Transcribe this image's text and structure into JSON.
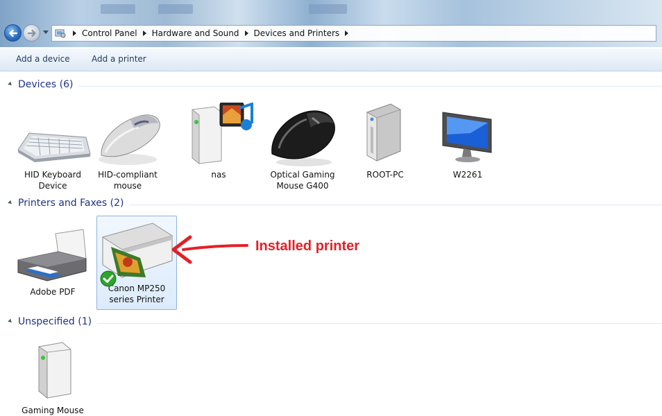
{
  "address": {
    "crumbs": [
      "Control Panel",
      "Hardware and Sound",
      "Devices and Printers"
    ]
  },
  "commands": {
    "add_device": "Add a device",
    "add_printer": "Add a printer"
  },
  "groups": {
    "devices": {
      "title": "Devices (6)",
      "items": [
        {
          "line1": "HID Keyboard",
          "line2": "Device",
          "icon": "keyboard-icon"
        },
        {
          "line1": "HID-compliant",
          "line2": "mouse",
          "icon": "mouse-icon"
        },
        {
          "line1": "nas",
          "line2": "",
          "icon": "media-server-icon"
        },
        {
          "line1": "Optical Gaming",
          "line2": "Mouse G400",
          "icon": "gaming-mouse-icon"
        },
        {
          "line1": "ROOT-PC",
          "line2": "",
          "icon": "computer-tower-icon"
        },
        {
          "line1": "W2261",
          "line2": "",
          "icon": "monitor-icon"
        }
      ]
    },
    "printers": {
      "title": "Printers and Faxes (2)",
      "items": [
        {
          "line1": "Adobe PDF",
          "line2": "",
          "icon": "printer-icon"
        },
        {
          "line1": "Canon MP250",
          "line2": "series Printer",
          "icon": "canon-printer-icon",
          "default": true
        }
      ]
    },
    "unspecified": {
      "title": "Unspecified (1)",
      "items": [
        {
          "line1": "Gaming Mouse",
          "line2": "",
          "icon": "generic-device-icon"
        }
      ]
    }
  },
  "annotation": {
    "text": "Installed printer",
    "color": "#e32026"
  }
}
